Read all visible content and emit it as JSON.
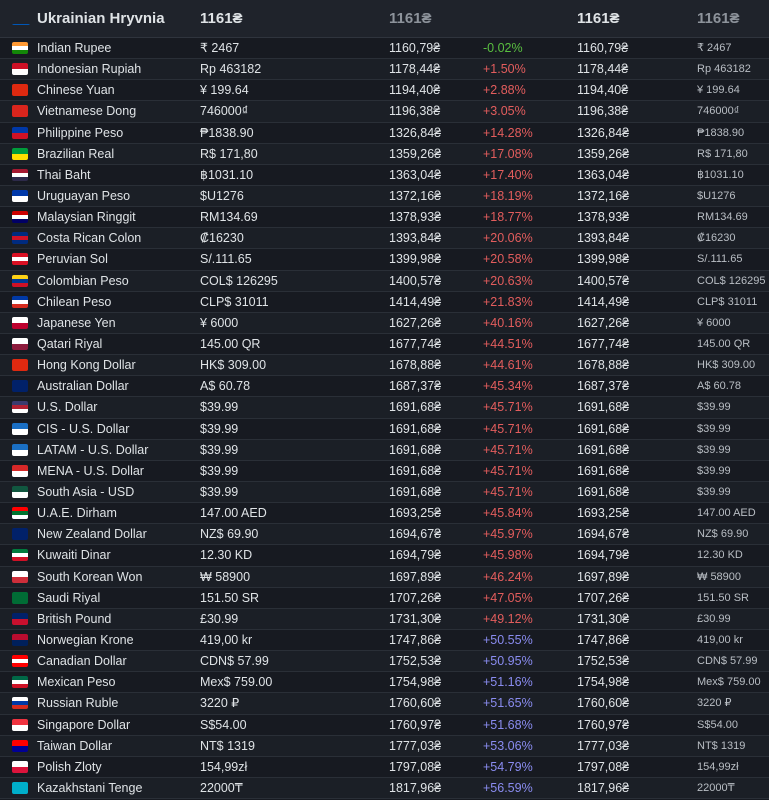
{
  "header": {
    "currency": "Ukrainian Hryvnia",
    "price": "1161₴",
    "uah": "1161₴",
    "uah2": "1161₴",
    "price2": "1161₴"
  },
  "colors": {
    "background": "#171a21",
    "negative_diff": "#59bf40",
    "positive_diff_low": "#e35d5d",
    "positive_diff_high": "#8a8cf0"
  },
  "rows": [
    {
      "flag": [
        "#ff9933",
        "#ffffff",
        "#138808"
      ],
      "name": "Indian Rupee",
      "price": "₹ 2467",
      "uah": "1160,79₴",
      "diff": "-0.02%",
      "uah2": "1160,79₴",
      "price2": "₹ 2467"
    },
    {
      "flag": [
        "#ce1126",
        "#ffffff"
      ],
      "name": "Indonesian Rupiah",
      "price": "Rp 463182",
      "uah": "1178,44₴",
      "diff": "+1.50%",
      "uah2": "1178,44₴",
      "price2": "Rp 463182"
    },
    {
      "flag": [
        "#de2910",
        "#de2910"
      ],
      "name": "Chinese Yuan",
      "price": "¥ 199.64",
      "uah": "1194,40₴",
      "diff": "+2.88%",
      "uah2": "1194,40₴",
      "price2": "¥ 199.64"
    },
    {
      "flag": [
        "#da251d",
        "#da251d"
      ],
      "name": "Vietnamese Dong",
      "price": "746000₫",
      "uah": "1196,38₴",
      "diff": "+3.05%",
      "uah2": "1196,38₴",
      "price2": "746000₫"
    },
    {
      "flag": [
        "#0038a8",
        "#ce1126"
      ],
      "name": "Philippine Peso",
      "price": "₱1838.90",
      "uah": "1326,84₴",
      "diff": "+14.28%",
      "uah2": "1326,84₴",
      "price2": "₱1838.90"
    },
    {
      "flag": [
        "#009c3b",
        "#ffdf00"
      ],
      "name": "Brazilian Real",
      "price": "R$ 171,80",
      "uah": "1359,26₴",
      "diff": "+17.08%",
      "uah2": "1359,26₴",
      "price2": "R$ 171,80"
    },
    {
      "flag": [
        "#a51931",
        "#ffffff",
        "#2d2a4a"
      ],
      "name": "Thai Baht",
      "price": "฿1031.10",
      "uah": "1363,04₴",
      "diff": "+17.40%",
      "uah2": "1363,04₴",
      "price2": "฿1031.10"
    },
    {
      "flag": [
        "#0038a8",
        "#ffffff"
      ],
      "name": "Uruguayan Peso",
      "price": "$U1276",
      "uah": "1372,16₴",
      "diff": "+18.19%",
      "uah2": "1372,16₴",
      "price2": "$U1276"
    },
    {
      "flag": [
        "#cc0001",
        "#ffffff",
        "#010066"
      ],
      "name": "Malaysian Ringgit",
      "price": "RM134.69",
      "uah": "1378,93₴",
      "diff": "+18.77%",
      "uah2": "1378,93₴",
      "price2": "RM134.69"
    },
    {
      "flag": [
        "#002b7f",
        "#ce1126",
        "#002b7f"
      ],
      "name": "Costa Rican Colon",
      "price": "₡16230",
      "uah": "1393,84₴",
      "diff": "+20.06%",
      "uah2": "1393,84₴",
      "price2": "₡16230"
    },
    {
      "flag": [
        "#d91023",
        "#ffffff",
        "#d91023"
      ],
      "name": "Peruvian Sol",
      "price": "S/.111.65",
      "uah": "1399,98₴",
      "diff": "+20.58%",
      "uah2": "1399,98₴",
      "price2": "S/.111.65"
    },
    {
      "flag": [
        "#fcd116",
        "#003893",
        "#ce1126"
      ],
      "name": "Colombian Peso",
      "price": "COL$ 126295",
      "uah": "1400,57₴",
      "diff": "+20.63%",
      "uah2": "1400,57₴",
      "price2": "COL$ 126295"
    },
    {
      "flag": [
        "#0039a6",
        "#ffffff",
        "#d52b1e"
      ],
      "name": "Chilean Peso",
      "price": "CLP$ 31011",
      "uah": "1414,49₴",
      "diff": "+21.83%",
      "uah2": "1414,49₴",
      "price2": "CLP$ 31011"
    },
    {
      "flag": [
        "#ffffff",
        "#bc002d"
      ],
      "name": "Japanese Yen",
      "price": "¥ 6000",
      "uah": "1627,26₴",
      "diff": "+40.16%",
      "uah2": "1627,26₴",
      "price2": "¥ 6000"
    },
    {
      "flag": [
        "#ffffff",
        "#8d1b3d"
      ],
      "name": "Qatari Riyal",
      "price": "145.00 QR",
      "uah": "1677,74₴",
      "diff": "+44.51%",
      "uah2": "1677,74₴",
      "price2": "145.00 QR"
    },
    {
      "flag": [
        "#de2910",
        "#de2910"
      ],
      "name": "Hong Kong Dollar",
      "price": "HK$ 309.00",
      "uah": "1678,88₴",
      "diff": "+44.61%",
      "uah2": "1678,88₴",
      "price2": "HK$ 309.00"
    },
    {
      "flag": [
        "#012169",
        "#012169"
      ],
      "name": "Australian Dollar",
      "price": "A$ 60.78",
      "uah": "1687,37₴",
      "diff": "+45.34%",
      "uah2": "1687,37₴",
      "price2": "A$ 60.78"
    },
    {
      "flag": [
        "#3c3b6e",
        "#b22234",
        "#ffffff"
      ],
      "name": "U.S. Dollar",
      "price": "$39.99",
      "uah": "1691,68₴",
      "diff": "+45.71%",
      "uah2": "1691,68₴",
      "price2": "$39.99"
    },
    {
      "flag": [
        "#1a6fc4",
        "#ffffff"
      ],
      "name": "CIS - U.S. Dollar",
      "price": "$39.99",
      "uah": "1691,68₴",
      "diff": "+45.71%",
      "uah2": "1691,68₴",
      "price2": "$39.99"
    },
    {
      "flag": [
        "#1a6fc4",
        "#ffffff"
      ],
      "name": "LATAM - U.S. Dollar",
      "price": "$39.99",
      "uah": "1691,68₴",
      "diff": "+45.71%",
      "uah2": "1691,68₴",
      "price2": "$39.99"
    },
    {
      "flag": [
        "#d72828",
        "#ffffff"
      ],
      "name": "MENA - U.S. Dollar",
      "price": "$39.99",
      "uah": "1691,68₴",
      "diff": "+45.71%",
      "uah2": "1691,68₴",
      "price2": "$39.99"
    },
    {
      "flag": [
        "#115740",
        "#ffffff"
      ],
      "name": "South Asia - USD",
      "price": "$39.99",
      "uah": "1691,68₴",
      "diff": "+45.71%",
      "uah2": "1691,68₴",
      "price2": "$39.99"
    },
    {
      "flag": [
        "#ff0000",
        "#00732f",
        "#ffffff"
      ],
      "name": "U.A.E. Dirham",
      "price": "147.00 AED",
      "uah": "1693,25₴",
      "diff": "+45.84%",
      "uah2": "1693,25₴",
      "price2": "147.00 AED"
    },
    {
      "flag": [
        "#012169",
        "#012169"
      ],
      "name": "New Zealand Dollar",
      "price": "NZ$ 69.90",
      "uah": "1694,67₴",
      "diff": "+45.97%",
      "uah2": "1694,67₴",
      "price2": "NZ$ 69.90"
    },
    {
      "flag": [
        "#007a3d",
        "#ffffff",
        "#ce1126"
      ],
      "name": "Kuwaiti Dinar",
      "price": "12.30 KD",
      "uah": "1694,79₴",
      "diff": "+45.98%",
      "uah2": "1694,79₴",
      "price2": "12.30 KD"
    },
    {
      "flag": [
        "#ffffff",
        "#cd2e3a"
      ],
      "name": "South Korean Won",
      "price": "₩ 58900",
      "uah": "1697,89₴",
      "diff": "+46.24%",
      "uah2": "1697,89₴",
      "price2": "₩ 58900"
    },
    {
      "flag": [
        "#006c35",
        "#006c35"
      ],
      "name": "Saudi Riyal",
      "price": "151.50 SR",
      "uah": "1707,26₴",
      "diff": "+47.05%",
      "uah2": "1707,26₴",
      "price2": "151.50 SR"
    },
    {
      "flag": [
        "#012169",
        "#c8102e"
      ],
      "name": "British Pound",
      "price": "£30.99",
      "uah": "1731,30₴",
      "diff": "+49.12%",
      "uah2": "1731,30₴",
      "price2": "£30.99"
    },
    {
      "flag": [
        "#ba0c2f",
        "#00205b"
      ],
      "name": "Norwegian Krone",
      "price": "419,00 kr",
      "uah": "1747,86₴",
      "diff": "+50.55%",
      "uah2": "1747,86₴",
      "price2": "419,00 kr"
    },
    {
      "flag": [
        "#ff0000",
        "#ffffff",
        "#ff0000"
      ],
      "name": "Canadian Dollar",
      "price": "CDN$ 57.99",
      "uah": "1752,53₴",
      "diff": "+50.95%",
      "uah2": "1752,53₴",
      "price2": "CDN$ 57.99"
    },
    {
      "flag": [
        "#006847",
        "#ffffff",
        "#ce1126"
      ],
      "name": "Mexican Peso",
      "price": "Mex$ 759.00",
      "uah": "1754,98₴",
      "diff": "+51.16%",
      "uah2": "1754,98₴",
      "price2": "Mex$ 759.00"
    },
    {
      "flag": [
        "#ffffff",
        "#0039a6",
        "#d52b1e"
      ],
      "name": "Russian Ruble",
      "price": "3220 ₽",
      "uah": "1760,60₴",
      "diff": "+51.65%",
      "uah2": "1760,60₴",
      "price2": "3220 ₽"
    },
    {
      "flag": [
        "#ef3340",
        "#ffffff"
      ],
      "name": "Singapore Dollar",
      "price": "S$54.00",
      "uah": "1760,97₴",
      "diff": "+51.68%",
      "uah2": "1760,97₴",
      "price2": "S$54.00"
    },
    {
      "flag": [
        "#fe0000",
        "#000095"
      ],
      "name": "Taiwan Dollar",
      "price": "NT$ 1319",
      "uah": "1777,03₴",
      "diff": "+53.06%",
      "uah2": "1777,03₴",
      "price2": "NT$ 1319"
    },
    {
      "flag": [
        "#ffffff",
        "#dc143c"
      ],
      "name": "Polish Zloty",
      "price": "154,99zł",
      "uah": "1797,08₴",
      "diff": "+54.79%",
      "uah2": "1797,08₴",
      "price2": "154,99zł"
    },
    {
      "flag": [
        "#00afca",
        "#00afca"
      ],
      "name": "Kazakhstani Tenge",
      "price": "22000₸",
      "uah": "1817,96₴",
      "diff": "+56.59%",
      "uah2": "1817,96₴",
      "price2": "22000₸"
    }
  ]
}
